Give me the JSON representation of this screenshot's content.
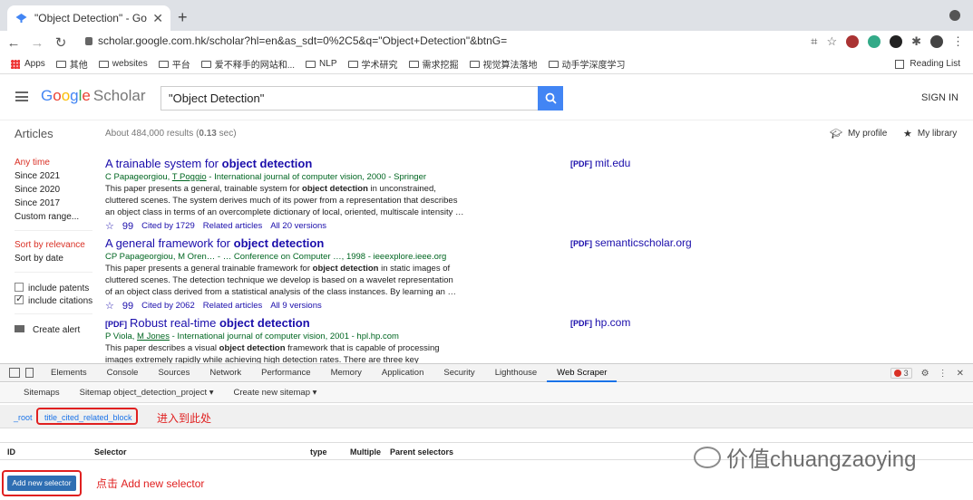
{
  "browser": {
    "tab_title": "\"Object Detection\" - Google Sc",
    "url": "scholar.google.com.hk/scholar?hl=en&as_sdt=0%2C5&q=\"Object+Detection\"&btnG=",
    "bookmarks": [
      "Apps",
      "其他",
      "websites",
      "平台",
      "爱不释手的网站和...",
      "NLP",
      "学术研究",
      "需求挖掘",
      "视觉算法落地",
      "动手学深度学习"
    ],
    "reading_list": "Reading List"
  },
  "scholar": {
    "logo_google": "Google",
    "logo_scholar": "Scholar",
    "query": "\"Object Detection\"",
    "sign_in": "SIGN IN",
    "articles_label": "Articles",
    "results_count_prefix": "About 484,000 results (",
    "results_count_time": "0.13",
    "results_count_suffix": " sec)",
    "my_profile": "My profile",
    "my_library": "My library"
  },
  "sidebar": {
    "time_filters": [
      "Any time",
      "Since 2021",
      "Since 2020",
      "Since 2017",
      "Custom range..."
    ],
    "sort": [
      "Sort by relevance",
      "Sort by date"
    ],
    "include_patents": "include patents",
    "include_citations": "include citations",
    "create_alert": "Create alert"
  },
  "results": [
    {
      "pdf_tag": "",
      "title_pre": "A trainable system for ",
      "title_bold": "object detection",
      "authors_pre": "C Papageorgiou, ",
      "authors_link": "T Poggio",
      "authors_post": " - International journal of computer vision, 2000 - Springer",
      "snippet_1_pre": "This paper presents a general, trainable system for ",
      "snippet_1_bold": "object detection",
      "snippet_1_post": " in unconstrained,",
      "snippet_2": "cluttered scenes. The system derives much of its power from a representation that describes",
      "snippet_3": "an object class in terms of an overcomplete dictionary of local, oriented, multiscale intensity …",
      "cited_by": "Cited by 1729",
      "related": "Related articles",
      "versions": "All 20 versions",
      "side_tag": "[PDF]",
      "side_source": "mit.edu"
    },
    {
      "pdf_tag": "",
      "title_pre": "A general framework for ",
      "title_bold": "object detection",
      "authors_pre": "CP Papageorgiou, M Oren… - … Conference on Computer …, 1998 - ieeexplore.ieee.org",
      "authors_link": "",
      "authors_post": "",
      "snippet_1_pre": "This paper presents a general trainable framework for ",
      "snippet_1_bold": "object detection",
      "snippet_1_post": " in static images of",
      "snippet_2": "cluttered scenes. The detection technique we develop is based on a wavelet representation",
      "snippet_3": "of an object class derived from a statistical analysis of the class instances. By learning an …",
      "cited_by": "Cited by 2062",
      "related": "Related articles",
      "versions": "All 9 versions",
      "side_tag": "[PDF]",
      "side_source": "semanticscholar.org"
    },
    {
      "pdf_tag": "[PDF]",
      "title_pre": "Robust real-time ",
      "title_bold": "object detection",
      "authors_pre": "P Viola, ",
      "authors_link": "M Jones",
      "authors_post": " - International journal of computer vision, 2001 - hpl.hp.com",
      "snippet_1_pre": "This paper describes a visual ",
      "snippet_1_bold": "object detection",
      "snippet_1_post": " framework that is capable of processing",
      "snippet_2": "images extremely rapidly while achieving high detection rates. There are three key",
      "snippet_3": "",
      "cited_by": "",
      "related": "",
      "versions": "",
      "side_tag": "[PDF]",
      "side_source": "hp.com"
    }
  ],
  "devtools": {
    "tabs": [
      "Elements",
      "Console",
      "Sources",
      "Network",
      "Performance",
      "Memory",
      "Application",
      "Security",
      "Lighthouse",
      "Web Scraper"
    ],
    "active_tab": "Web Scraper",
    "error_count": "3",
    "ws_menu": [
      "Sitemaps",
      "Sitemap object_detection_project ▾",
      "Create new sitemap ▾"
    ],
    "breadcrumb_root": "_root",
    "breadcrumb_current": "title_cited_related_block",
    "annotation_enter": "进入到此处",
    "table_headers": [
      "ID",
      "Selector",
      "type",
      "Multiple",
      "Parent selectors"
    ],
    "add_selector": "Add new selector",
    "annotation_click": "点击 Add new selector"
  },
  "watermark": "价值chuangzaoying",
  "colors": {
    "accent_blue": "#4285f4",
    "link_blue": "#1a0dab",
    "author_green": "#006621",
    "annotation_red": "#e02020",
    "filter_red": "#d93025"
  }
}
